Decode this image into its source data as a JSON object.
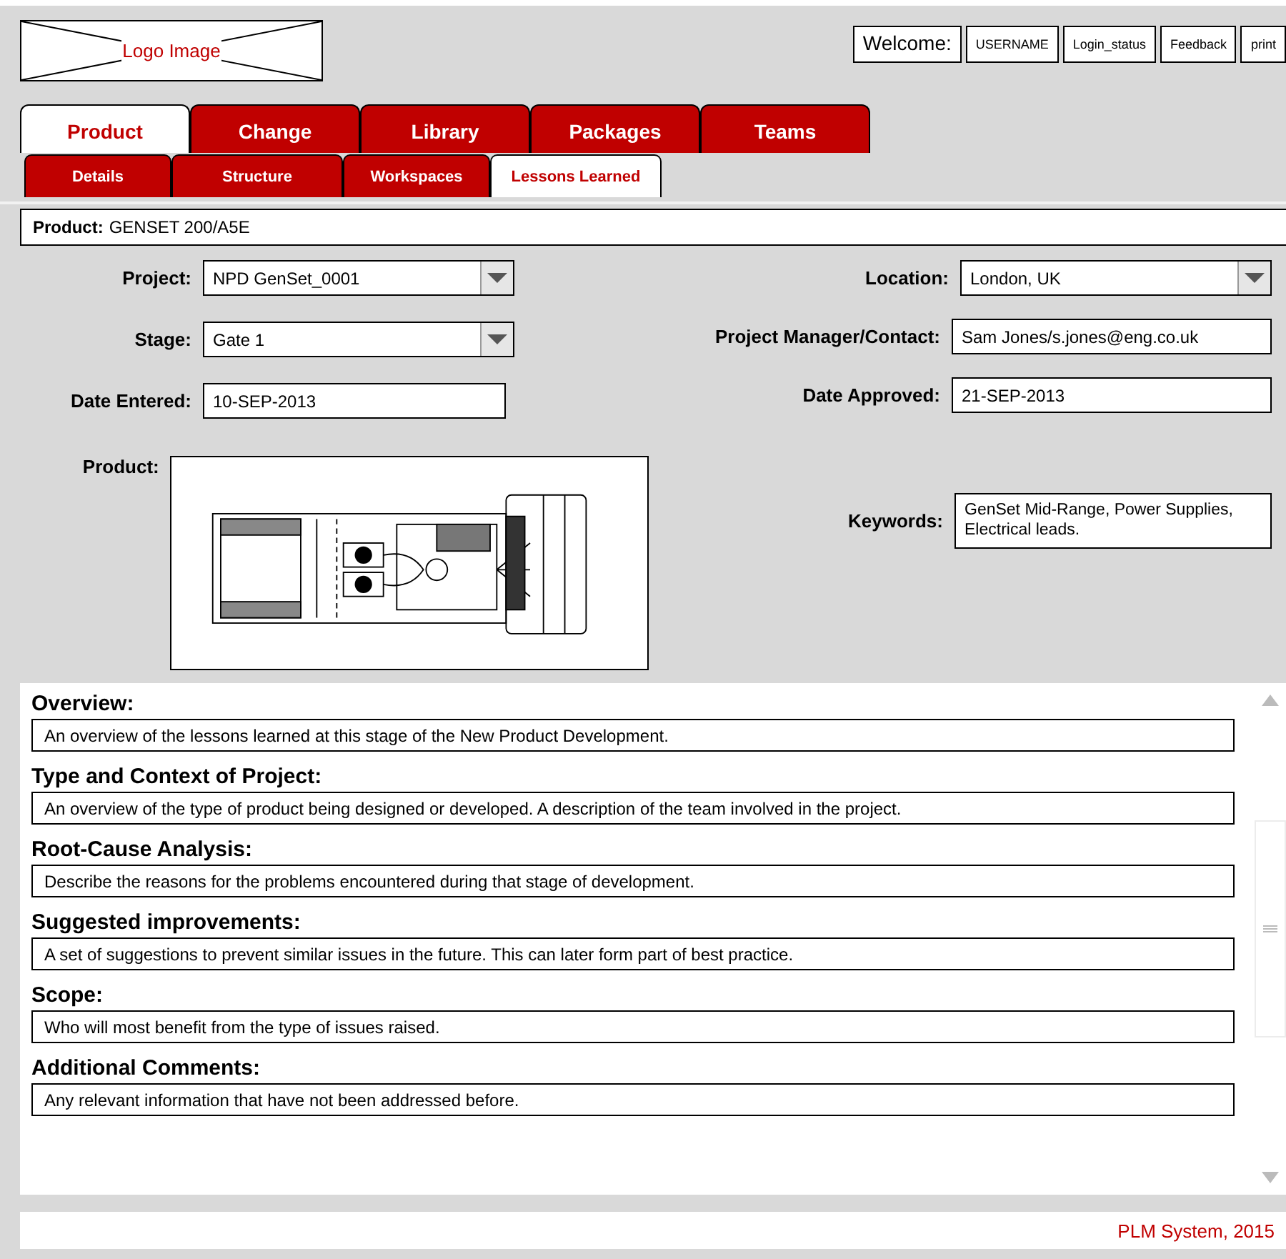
{
  "logo": {
    "text": "Logo Image"
  },
  "user_bar": {
    "welcome": "Welcome:",
    "buttons": [
      "USERNAME",
      "Login_status",
      "Feedback",
      "print"
    ]
  },
  "tabs": [
    {
      "label": "Product",
      "selected": true
    },
    {
      "label": "Change",
      "selected": false
    },
    {
      "label": "Library",
      "selected": false
    },
    {
      "label": "Packages",
      "selected": false
    },
    {
      "label": "Teams",
      "selected": false
    }
  ],
  "subtabs": [
    {
      "label": "Details",
      "selected": false
    },
    {
      "label": "Structure",
      "selected": false
    },
    {
      "label": "Workspaces",
      "selected": false
    },
    {
      "label": "Lessons Learned",
      "selected": true
    }
  ],
  "product_bar": {
    "label": "Product:",
    "value": "GENSET 200/A5E"
  },
  "left_fields": [
    {
      "label": "Project:",
      "kind": "dropdown",
      "value": "NPD GenSet_0001"
    },
    {
      "label": "Stage:",
      "kind": "dropdown",
      "value": "Gate 1"
    },
    {
      "label": "Date Entered:",
      "kind": "text",
      "value": "10-SEP-2013"
    },
    {
      "label": "Product:",
      "kind": "image"
    }
  ],
  "right_fields": [
    {
      "label": "Location:",
      "kind": "dropdown",
      "value": "London, UK"
    },
    {
      "label": "Project Manager/Contact:",
      "kind": "text",
      "value": "Sam Jones/s.jones@eng.co.uk"
    },
    {
      "label": "Date Approved:",
      "kind": "text",
      "value": "21-SEP-2013"
    },
    {
      "label": "Keywords:",
      "kind": "multiline",
      "value": "GenSet Mid-Range, Power Supplies, Electrical leads."
    }
  ],
  "sections": [
    {
      "heading": "Overview:",
      "text": "An overview of the lessons learned at this stage of the New Product Development."
    },
    {
      "heading": "Type and Context of Project:",
      "text": "An overview of the type of product being designed or developed. A description of the team involved in the project."
    },
    {
      "heading": "Root-Cause Analysis:",
      "text": "Describe the reasons for the problems encountered during that stage of development."
    },
    {
      "heading": "Suggested improvements:",
      "text": "A set of suggestions to prevent similar issues in the future. This can later form part of best practice."
    },
    {
      "heading": "Scope:",
      "text": "Who will most benefit from the type of issues raised."
    },
    {
      "heading": "Additional Comments:",
      "text": "Any relevant information that have not been addressed before."
    }
  ],
  "footer": {
    "text": "PLM System, 2015"
  }
}
